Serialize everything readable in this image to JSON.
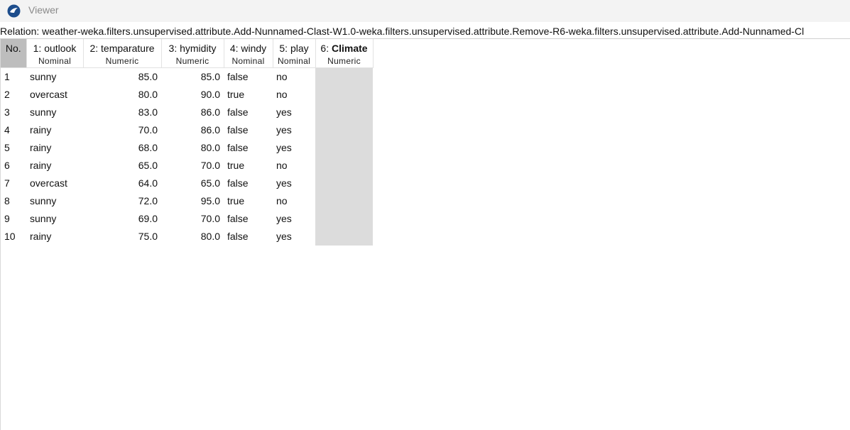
{
  "window": {
    "title": "Viewer"
  },
  "relation": "Relation: weather-weka.filters.unsupervised.attribute.Add-Nunnamed-Clast-W1.0-weka.filters.unsupervised.attribute.Remove-R6-weka.filters.unsupervised.attribute.Add-Nunnamed-Cl",
  "table": {
    "no_header": "No.",
    "columns": [
      {
        "index": "1:",
        "name": "outlook",
        "type": "Nominal"
      },
      {
        "index": "2:",
        "name": "temparature",
        "type": "Numeric"
      },
      {
        "index": "3:",
        "name": "hymidity",
        "type": "Numeric"
      },
      {
        "index": "4:",
        "name": "windy",
        "type": "Nominal"
      },
      {
        "index": "5:",
        "name": "play",
        "type": "Nominal"
      },
      {
        "index": "6:",
        "name": "Climate",
        "type": "Numeric"
      }
    ],
    "rows": [
      {
        "no": "1",
        "outlook": "sunny",
        "temparature": "85.0",
        "hymidity": "85.0",
        "windy": "false",
        "play": "no",
        "climate": ""
      },
      {
        "no": "2",
        "outlook": "overcast",
        "temparature": "80.0",
        "hymidity": "90.0",
        "windy": "true",
        "play": "no",
        "climate": ""
      },
      {
        "no": "3",
        "outlook": "sunny",
        "temparature": "83.0",
        "hymidity": "86.0",
        "windy": "false",
        "play": "yes",
        "climate": ""
      },
      {
        "no": "4",
        "outlook": "rainy",
        "temparature": "70.0",
        "hymidity": "86.0",
        "windy": "false",
        "play": "yes",
        "climate": ""
      },
      {
        "no": "5",
        "outlook": "rainy",
        "temparature": "68.0",
        "hymidity": "80.0",
        "windy": "false",
        "play": "yes",
        "climate": ""
      },
      {
        "no": "6",
        "outlook": "rainy",
        "temparature": "65.0",
        "hymidity": "70.0",
        "windy": "true",
        "play": "no",
        "climate": ""
      },
      {
        "no": "7",
        "outlook": "overcast",
        "temparature": "64.0",
        "hymidity": "65.0",
        "windy": "false",
        "play": "yes",
        "climate": ""
      },
      {
        "no": "8",
        "outlook": "sunny",
        "temparature": "72.0",
        "hymidity": "95.0",
        "windy": "true",
        "play": "no",
        "climate": ""
      },
      {
        "no": "9",
        "outlook": "sunny",
        "temparature": "69.0",
        "hymidity": "70.0",
        "windy": "false",
        "play": "yes",
        "climate": ""
      },
      {
        "no": "10",
        "outlook": "rainy",
        "temparature": "75.0",
        "hymidity": "80.0",
        "windy": "false",
        "play": "yes",
        "climate": ""
      }
    ]
  },
  "colors": {
    "title_text": "#8a8a8a",
    "no_header_bg": "#bdbdbd",
    "missing_cell_bg": "#dcdcdc",
    "app_icon": "#1d4d8c"
  },
  "icons": {
    "app": "weka-bird-icon"
  }
}
